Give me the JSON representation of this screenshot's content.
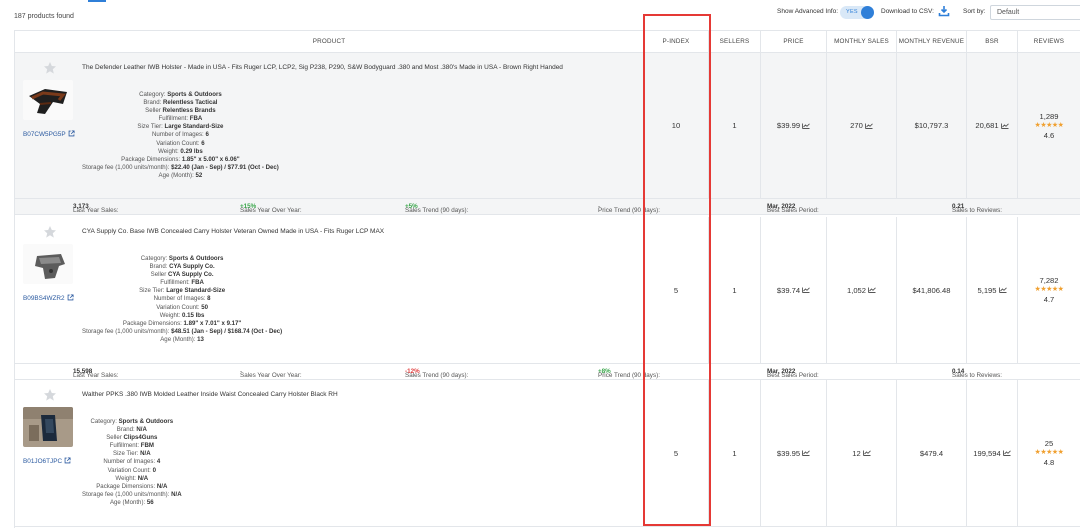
{
  "toolbar": {
    "products_found": "187 products found",
    "advanced_label": "Show Advanced Info:",
    "advanced_value": "YES",
    "csv_label": "Download to CSV:",
    "sort_label": "Sort by:",
    "sort_value": "Default"
  },
  "columns": [
    "PRODUCT",
    "P-INDEX",
    "SELLERS",
    "PRICE",
    "MONTHLY SALES",
    "MONTHLY REVENUE",
    "BSR",
    "REVIEWS"
  ],
  "colors": {
    "accent": "#2f7fd8",
    "highlight_border": "#e53935",
    "positive": "#3aa64b",
    "negative": "#e04040",
    "star": "#f0a030"
  },
  "products": [
    {
      "title": "The Defender Leather IWB Holster - Made in USA - Fits Ruger LCP, LCP2, Sig P238, P290, S&W Bodyguard .380 and Most .380's Made in USA - Brown Right Handed",
      "asin": "B07CW5PG5P",
      "details": [
        {
          "k": "Category:",
          "v": "Sports & Outdoors"
        },
        {
          "k": "Brand:",
          "v": "Relentless Tactical"
        },
        {
          "k": "Seller",
          "v": "Relentless Brands"
        },
        {
          "k": "Fulfillment:",
          "v": "FBA"
        },
        {
          "k": "Size Tier:",
          "v": "Large Standard-Size"
        },
        {
          "k": "Number of Images:",
          "v": "6"
        },
        {
          "k": "Variation Count:",
          "v": "6"
        },
        {
          "k": "Weight:",
          "v": "0.29 lbs"
        },
        {
          "k": "Package Dimensions:",
          "v": "1.85\" x 5.00\" x 6.06\""
        },
        {
          "k": "Storage fee (1,000 units/month):",
          "v": "$22.40 (Jan - Sep) / $77.91 (Oct - Dec)"
        },
        {
          "k": "Age (Month):",
          "v": "52"
        }
      ],
      "p_index": "10",
      "sellers": "1",
      "price": "$39.99",
      "monthly_sales": "270",
      "monthly_revenue": "$10,797.3",
      "bsr": "20,681",
      "reviews": "1,289",
      "rating": "4.6",
      "summary": {
        "last_year_label": "Last Year Sales:",
        "last_year": "3,173",
        "yoy_label": "Sales Year Over Year:",
        "yoy": "+15%",
        "yoy_class": "pos",
        "trend_label": "Sales Trend (90 days):",
        "trend": "+5%",
        "trend_class": "pos",
        "price_trend_label": "Price Trend (90 days):",
        "price_trend": "-",
        "price_trend_class": "",
        "best_label": "Best Sales Period:",
        "best": "Mar, 2022",
        "ratio_label": "Sales to Reviews:",
        "ratio": "0.21"
      }
    },
    {
      "title": "CYA Supply Co. Base IWB Concealed Carry Holster Veteran Owned Made in USA - Fits Ruger LCP MAX",
      "asin": "B09BS4WZR2",
      "details": [
        {
          "k": "Category:",
          "v": "Sports & Outdoors"
        },
        {
          "k": "Brand:",
          "v": "CYA Supply Co."
        },
        {
          "k": "Seller",
          "v": "CYA Supply Co."
        },
        {
          "k": "Fulfillment:",
          "v": "FBA"
        },
        {
          "k": "Size Tier:",
          "v": "Large Standard-Size"
        },
        {
          "k": "Number of Images:",
          "v": "8"
        },
        {
          "k": "Variation Count:",
          "v": "50"
        },
        {
          "k": "Weight:",
          "v": "0.15 lbs"
        },
        {
          "k": "Package Dimensions:",
          "v": "1.89\" x 7.01\" x 9.17\""
        },
        {
          "k": "Storage fee (1,000 units/month):",
          "v": "$48.51 (Jan - Sep) / $168.74 (Oct - Dec)"
        },
        {
          "k": "Age (Month):",
          "v": "13"
        }
      ],
      "p_index": "5",
      "sellers": "1",
      "price": "$39.74",
      "monthly_sales": "1,052",
      "monthly_revenue": "$41,806.48",
      "bsr": "5,195",
      "reviews": "7,282",
      "rating": "4.7",
      "summary": {
        "last_year_label": "Last Year Sales:",
        "last_year": "15,598",
        "yoy_label": "Sales Year Over Year:",
        "yoy": "-",
        "yoy_class": "",
        "trend_label": "Sales Trend (90 days):",
        "trend": "-12%",
        "trend_class": "neg",
        "price_trend_label": "Price Trend (90 days):",
        "price_trend": "+8%",
        "price_trend_class": "pos",
        "best_label": "Best Sales Period:",
        "best": "Mar, 2022",
        "ratio_label": "Sales to Reviews:",
        "ratio": "0.14"
      }
    },
    {
      "title": "Walther PPKS .380 IWB Molded Leather Inside Waist Concealed Carry Holster Black RH",
      "asin": "B01JO6TJPC",
      "details": [
        {
          "k": "Category:",
          "v": "Sports & Outdoors"
        },
        {
          "k": "Brand:",
          "v": "N/A"
        },
        {
          "k": "Seller",
          "v": "Clips4Guns"
        },
        {
          "k": "Fulfillment:",
          "v": "FBM"
        },
        {
          "k": "Size Tier:",
          "v": "N/A"
        },
        {
          "k": "Number of Images:",
          "v": "4"
        },
        {
          "k": "Variation Count:",
          "v": "0"
        },
        {
          "k": "Weight:",
          "v": "N/A"
        },
        {
          "k": "Package Dimensions:",
          "v": "N/A"
        },
        {
          "k": "Storage fee (1,000 units/month):",
          "v": "N/A"
        },
        {
          "k": "Age (Month):",
          "v": "56"
        }
      ],
      "p_index": "5",
      "sellers": "1",
      "price": "$39.95",
      "monthly_sales": "12",
      "monthly_revenue": "$479.4",
      "bsr": "199,594",
      "reviews": "25",
      "rating": "4.8"
    }
  ]
}
